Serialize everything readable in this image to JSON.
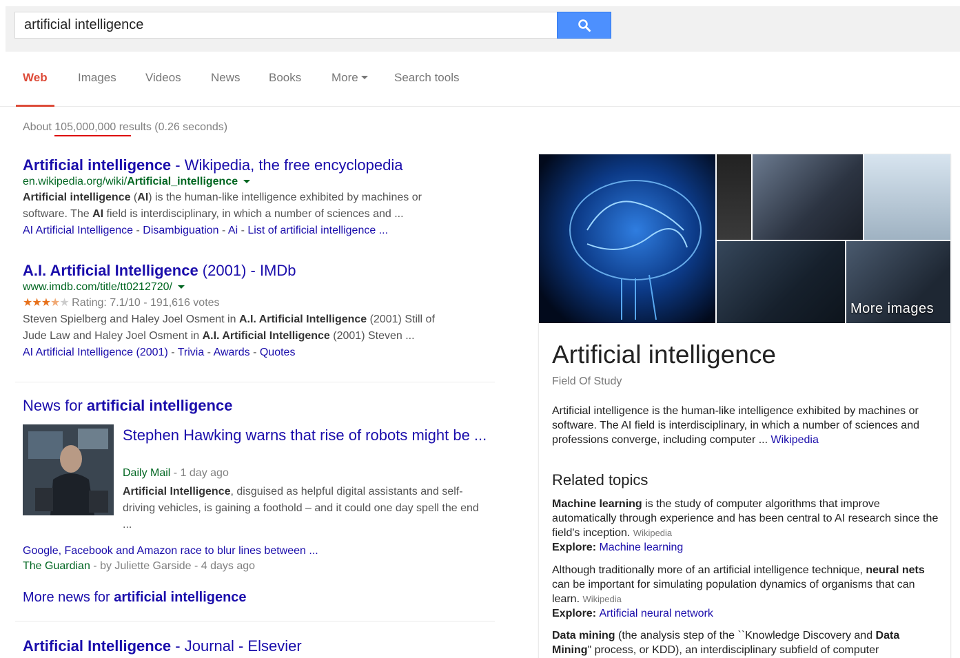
{
  "search": {
    "query": "artificial intelligence"
  },
  "tabs": [
    "Web",
    "Images",
    "Videos",
    "News",
    "Books",
    "More",
    "Search tools"
  ],
  "result_stats": {
    "prefix": "About ",
    "count": "105,000,000",
    "suffix": " results (0.26 seconds)"
  },
  "results": [
    {
      "title_a": "Artificial intelligence",
      "title_b": " - Wikipedia, the free encyclopedia",
      "url_a": "en.wikipedia.org/wiki/",
      "url_b": "Artificial_intelligence",
      "snippet_1b": "Artificial intelligence",
      "snippet_1c": " (",
      "snippet_1d": "AI",
      "snippet_1e": ") is the human-like intelligence exhibited by machines or",
      "snippet_2a": "software. The ",
      "snippet_2b": "AI",
      "snippet_2c": " field is interdisciplinary, in which a number of sciences and ...",
      "sitelinks": [
        "AI Artificial Intelligence",
        "Disambiguation",
        "Ai",
        "List of artificial intelligence ..."
      ]
    },
    {
      "title_a": "A.I. Artificial Intelligence",
      "title_b": " (2001) - IMDb",
      "url": "www.imdb.com/title/tt0212720/",
      "rating": "Rating: 7.1/10 - 191,616 votes",
      "stars_full": "★★★",
      "stars_half": "★",
      "stars_empty": "★",
      "s1a": "Steven Spielberg and Haley Joel Osment in ",
      "s1b": "A.I. Artificial Intelligence",
      "s1c": " (2001) Still of",
      "s2a": "Jude Law and Haley Joel Osment in ",
      "s2b": "A.I. Artificial Intelligence",
      "s2c": " (2001) Steven ...",
      "sitelinks": [
        "AI Artificial Intelligence (2001)",
        "Trivia",
        "Awards",
        "Quotes"
      ]
    },
    {
      "title_a": "Artificial Intelligence",
      "title_b": " - Journal - Elsevier"
    }
  ],
  "news": {
    "header_a": "News for ",
    "header_b": "artificial intelligence",
    "main": {
      "title": "Stephen Hawking warns that rise of robots might be ...",
      "source": "Daily Mail",
      "meta": " - 1 day ago",
      "snip_b": "Artificial Intelligence",
      "snip_rest": ", disguised as helpful digital assistants and self-driving vehicles, is gaining a foothold – and it could one day spell the end ..."
    },
    "second": {
      "title": "Google, Facebook and Amazon race to blur lines between ...",
      "source": "The Guardian",
      "meta": " - by Juliette Garside - 4 days ago"
    },
    "more_a": "More news for ",
    "more_b": "artificial intelligence"
  },
  "knowledge_panel": {
    "more_images": "More images",
    "title": "Artificial intelligence",
    "subtitle": "Field Of Study",
    "description": "Artificial intelligence is the human-like intelligence exhibited by machines or software. The AI field is interdisciplinary, in which a number of sciences and professions converge, including computer ... ",
    "description_link": "Wikipedia",
    "related_heading": "Related topics",
    "topics": [
      {
        "bold": "Machine learning",
        "text": " is the study of computer algorithms that improve automatically through experience and has been central to AI research since the field's inception. ",
        "source": "Wikipedia",
        "explore_label": "Explore: ",
        "explore_link": "Machine learning"
      },
      {
        "pre": "Although traditionally more of an artificial intelligence technique, ",
        "bold": "neural nets",
        "text": " can be important for simulating population dynamics of organisms that can learn. ",
        "source": "Wikipedia",
        "explore_label": "Explore: ",
        "explore_link": "Artificial neural network"
      },
      {
        "bold": "Data mining",
        "text": " (the analysis step of the ``Knowledge Discovery and ",
        "bold2": "Data Mining",
        "text2": "\" process, or KDD), an interdisciplinary subfield of computer"
      }
    ]
  },
  "colors": {
    "link": "#1a0dab",
    "url": "#006621",
    "active_tab": "#dd4b39",
    "search_button": "#4d90fe"
  }
}
